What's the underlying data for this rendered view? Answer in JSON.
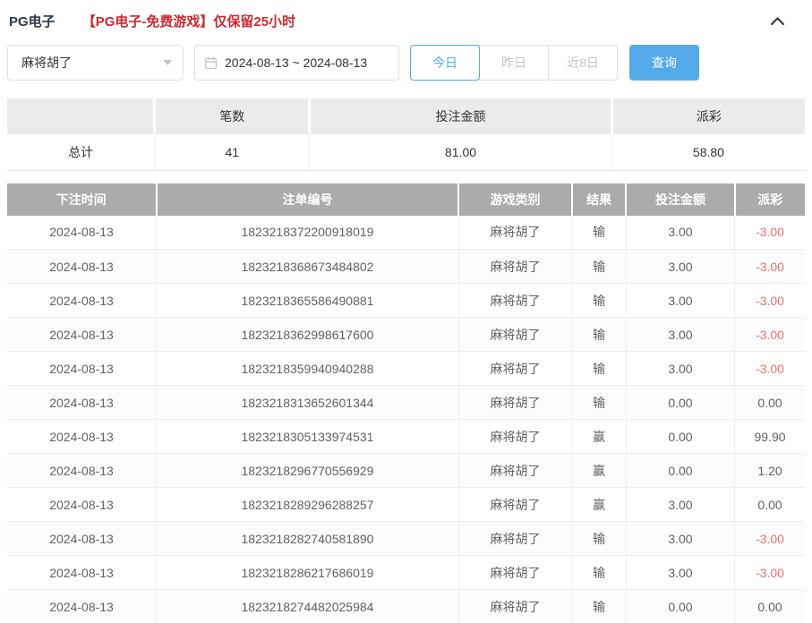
{
  "header": {
    "title": "PG电子",
    "notice": "【PG电子-免费游戏】仅保留25小时"
  },
  "filters": {
    "game_select": {
      "value": "麻将胡了"
    },
    "date_range": {
      "value": "2024-08-13 ~ 2024-08-13"
    },
    "quick_buttons": [
      {
        "label": "今日",
        "active": true
      },
      {
        "label": "昨日",
        "active": false
      },
      {
        "label": "近8日",
        "active": false
      }
    ],
    "search_label": "查询"
  },
  "summary": {
    "columns": [
      "",
      "笔数",
      "投注金额",
      "派彩"
    ],
    "row": {
      "label": "总计",
      "count": "41",
      "bet_amount": "81.00",
      "payout": "58.80"
    }
  },
  "table": {
    "columns": [
      "下注时间",
      "注单编号",
      "游戏类别",
      "结果",
      "投注金额",
      "派彩"
    ],
    "rows": [
      {
        "date": "2024-08-13",
        "order_no": "1823218372200918019",
        "game": "麻将胡了",
        "result": "输",
        "bet": "3.00",
        "payout": "-3.00"
      },
      {
        "date": "2024-08-13",
        "order_no": "1823218368673484802",
        "game": "麻将胡了",
        "result": "输",
        "bet": "3.00",
        "payout": "-3.00"
      },
      {
        "date": "2024-08-13",
        "order_no": "1823218365586490881",
        "game": "麻将胡了",
        "result": "输",
        "bet": "3.00",
        "payout": "-3.00"
      },
      {
        "date": "2024-08-13",
        "order_no": "1823218362998617600",
        "game": "麻将胡了",
        "result": "输",
        "bet": "3.00",
        "payout": "-3.00"
      },
      {
        "date": "2024-08-13",
        "order_no": "1823218359940940288",
        "game": "麻将胡了",
        "result": "输",
        "bet": "3.00",
        "payout": "-3.00"
      },
      {
        "date": "2024-08-13",
        "order_no": "1823218313652601344",
        "game": "麻将胡了",
        "result": "输",
        "bet": "0.00",
        "payout": "0.00"
      },
      {
        "date": "2024-08-13",
        "order_no": "1823218305133974531",
        "game": "麻将胡了",
        "result": "赢",
        "bet": "0.00",
        "payout": "99.90"
      },
      {
        "date": "2024-08-13",
        "order_no": "1823218296770556929",
        "game": "麻将胡了",
        "result": "赢",
        "bet": "0.00",
        "payout": "1.20"
      },
      {
        "date": "2024-08-13",
        "order_no": "1823218289296288257",
        "game": "麻将胡了",
        "result": "赢",
        "bet": "3.00",
        "payout": "0.00"
      },
      {
        "date": "2024-08-13",
        "order_no": "1823218282740581890",
        "game": "麻将胡了",
        "result": "输",
        "bet": "3.00",
        "payout": "-3.00"
      },
      {
        "date": "2024-08-13",
        "order_no": "1823218286217686019",
        "game": "麻将胡了",
        "result": "输",
        "bet": "3.00",
        "payout": "-3.00"
      },
      {
        "date": "2024-08-13",
        "order_no": "1823218274482025984",
        "game": "麻将胡了",
        "result": "输",
        "bet": "0.00",
        "payout": "0.00"
      }
    ]
  },
  "colors": {
    "accent_blue": "#55aae9",
    "danger_red": "#f56c6c",
    "notice_red": "#cb2a2f",
    "table_header_bg": "#ababab",
    "summary_header_bg": "#ebebeb"
  }
}
